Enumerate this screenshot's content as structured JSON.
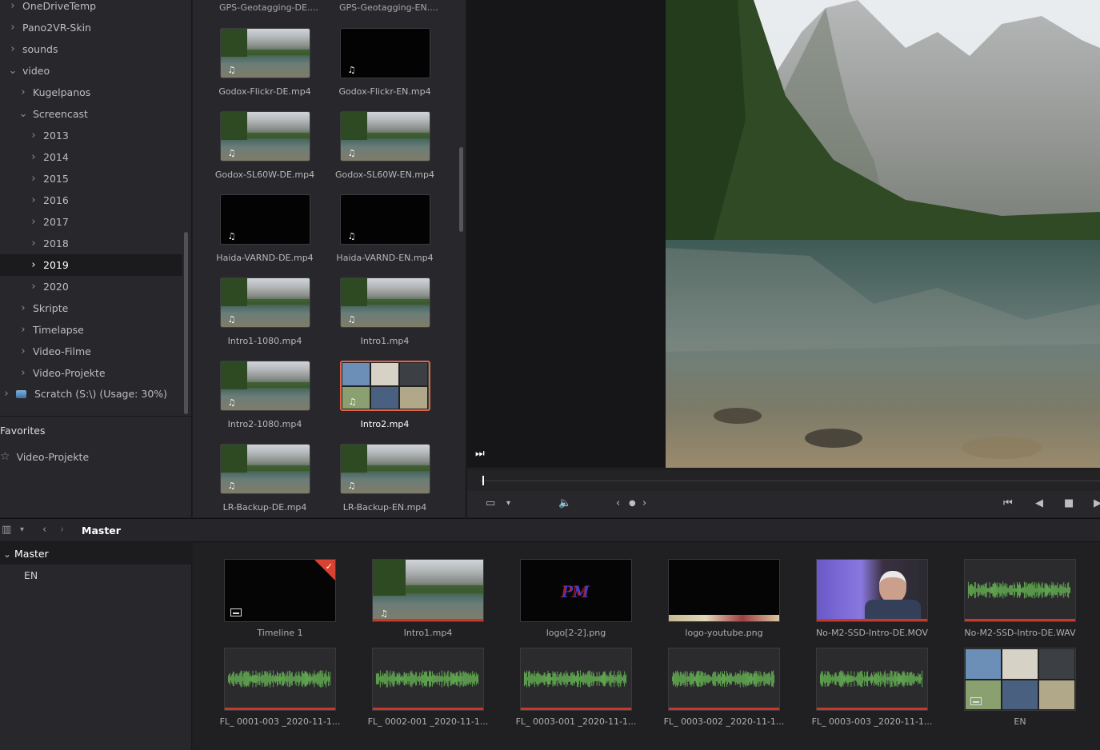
{
  "tree": {
    "items": [
      {
        "label": "OneDriveTemp",
        "chev": "›",
        "indent": 0
      },
      {
        "label": "Pano2VR-Skin",
        "chev": "›",
        "indent": 0
      },
      {
        "label": "sounds",
        "chev": "›",
        "indent": 0
      },
      {
        "label": "video",
        "chev": "⌄",
        "indent": 0
      },
      {
        "label": "Kugelpanos",
        "chev": "›",
        "indent": 1
      },
      {
        "label": "Screencast",
        "chev": "⌄",
        "indent": 1
      },
      {
        "label": "2013",
        "chev": "›",
        "indent": 2
      },
      {
        "label": "2014",
        "chev": "›",
        "indent": 2
      },
      {
        "label": "2015",
        "chev": "›",
        "indent": 2
      },
      {
        "label": "2016",
        "chev": "›",
        "indent": 2
      },
      {
        "label": "2017",
        "chev": "›",
        "indent": 2
      },
      {
        "label": "2018",
        "chev": "›",
        "indent": 2
      },
      {
        "label": "2019",
        "chev": "›",
        "indent": 2,
        "selected": true
      },
      {
        "label": "2020",
        "chev": "›",
        "indent": 2
      },
      {
        "label": "Skripte",
        "chev": "›",
        "indent": 1
      },
      {
        "label": "Timelapse",
        "chev": "›",
        "indent": 1
      },
      {
        "label": "Video-Filme",
        "chev": "›",
        "indent": 1
      },
      {
        "label": "Video-Projekte",
        "chev": "›",
        "indent": 1
      }
    ],
    "scratch_label": "Scratch (S:\\) (Usage: 30%)",
    "favorites_title": "Favorites",
    "favorite_item": "Video-Projekte"
  },
  "browser": {
    "top_captions": [
      "GPS-Geotagging-DE....",
      "GPS-Geotagging-EN...."
    ],
    "files": [
      {
        "name": "Godox-Flickr-DE.mp4",
        "kind": "landscape"
      },
      {
        "name": "Godox-Flickr-EN.mp4",
        "kind": "black"
      },
      {
        "name": "Godox-SL60W-DE.mp4",
        "kind": "landscape"
      },
      {
        "name": "Godox-SL60W-EN.mp4",
        "kind": "landscape"
      },
      {
        "name": "Haida-VARND-DE.mp4",
        "kind": "black"
      },
      {
        "name": "Haida-VARND-EN.mp4",
        "kind": "black"
      },
      {
        "name": "Intro1-1080.mp4",
        "kind": "landscape"
      },
      {
        "name": "Intro1.mp4",
        "kind": "landscape"
      },
      {
        "name": "Intro2-1080.mp4",
        "kind": "landscape"
      },
      {
        "name": "Intro2.mp4",
        "kind": "collage",
        "selected": true
      },
      {
        "name": "LR-Backup-DE.mp4",
        "kind": "landscape"
      },
      {
        "name": "LR-Backup-EN.mp4",
        "kind": "landscape"
      }
    ],
    "audio_glyph": "♫"
  },
  "viewer": {
    "controls": {
      "end": "⏭",
      "volume": "🔈",
      "prev": "‹",
      "dot": "●",
      "next": "›",
      "first": "⏮",
      "back": "◀",
      "stop": "■",
      "play": "▶"
    }
  },
  "pool": {
    "title": "Master",
    "bins": [
      {
        "label": "Master",
        "chev": "⌄",
        "selected": true
      },
      {
        "label": "EN",
        "chev": "",
        "selected": false
      }
    ],
    "clips": [
      {
        "name": "Timeline 1",
        "kind": "timeline"
      },
      {
        "name": "Intro1.mp4",
        "kind": "landscape"
      },
      {
        "name": "logo[2-2].png",
        "kind": "logo",
        "logo_text": "PM"
      },
      {
        "name": "logo-youtube.png",
        "kind": "ytlogo"
      },
      {
        "name": "No-M2-SSD-Intro-DE.MOV",
        "kind": "person"
      },
      {
        "name": "No-M2-SSD-Intro-DE.WAV",
        "kind": "wave"
      },
      {
        "name": "FL_ 0001-003 _2020-11-1...",
        "kind": "wave"
      },
      {
        "name": "FL_ 0002-001 _2020-11-1...",
        "kind": "wave"
      },
      {
        "name": "FL_ 0003-001 _2020-11-1...",
        "kind": "wave"
      },
      {
        "name": "FL_ 0003-002 _2020-11-1...",
        "kind": "wave"
      },
      {
        "name": "FL_ 0003-003 _2020-11-1...",
        "kind": "wave"
      },
      {
        "name": "EN",
        "kind": "collage"
      }
    ]
  },
  "colors": {
    "accent": "#e2654b",
    "clip_red": "#c7392a",
    "wave_green": "#5fa34f"
  }
}
